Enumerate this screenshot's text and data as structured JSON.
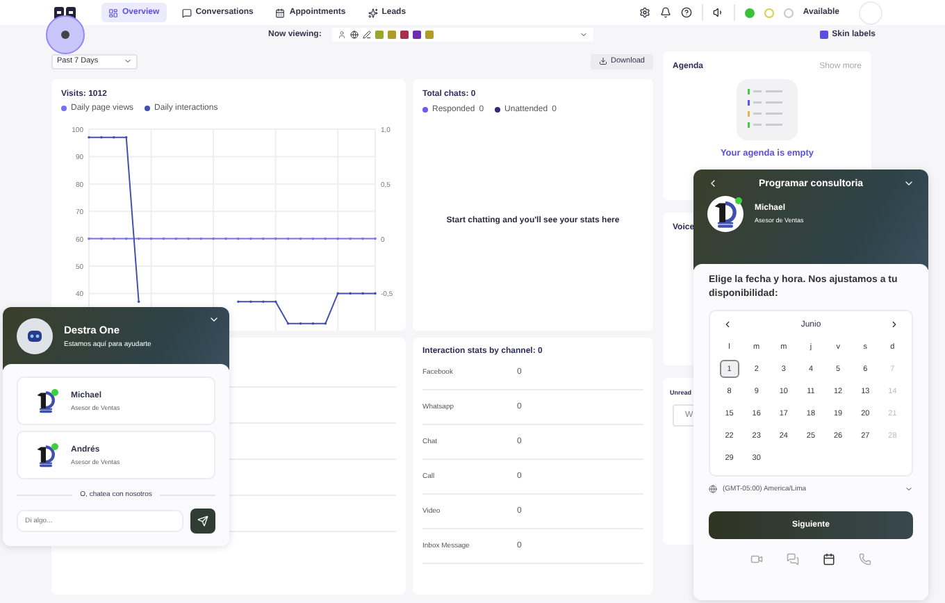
{
  "nav": {
    "tabs": [
      {
        "label": "Overview",
        "selected": true
      },
      {
        "label": "Conversations",
        "selected": false
      },
      {
        "label": "Appointments",
        "selected": false
      },
      {
        "label": "Leads",
        "selected": false
      }
    ],
    "statuses": [
      {
        "color": "#3cc03c",
        "selected": true
      },
      {
        "color": "#d8d040",
        "selected": false
      },
      {
        "color": "#c8c8cc",
        "selected": false
      }
    ],
    "status_label": "Available"
  },
  "viewing": {
    "label": "Now viewing:",
    "tags": [
      {
        "color": "#9aa52a"
      },
      {
        "color": "#b09a2a"
      },
      {
        "color": "#a8304c"
      },
      {
        "color": "#6e2cae"
      },
      {
        "color": "#b09a2a"
      }
    ]
  },
  "skin_labels": {
    "label": "Skin labels",
    "checked": true
  },
  "period": {
    "value": "Past 7 Days"
  },
  "download": "Download",
  "visits": {
    "title": "Visits: 1012",
    "chart_data": {
      "type": "line",
      "grid": true,
      "ylim": [
        25,
        100
      ],
      "yticks": [
        40,
        50,
        60,
        70,
        80,
        90,
        100
      ],
      "y2lim": [
        -0.875,
        1
      ],
      "y2ticks": [
        {
          "value": -0.5,
          "label": "-0,5"
        },
        {
          "value": 0,
          "label": "0"
        },
        {
          "value": 0.5,
          "label": "0,5"
        },
        {
          "value": 1,
          "label": "1,0"
        }
      ],
      "series": [
        {
          "name": "Daily page views",
          "color": "#7a70f0",
          "values": [
            60,
            60,
            60,
            60,
            60,
            60,
            60,
            60,
            60,
            60,
            60,
            60,
            60,
            60,
            60,
            60,
            60,
            60,
            60,
            60,
            60,
            60,
            60,
            60
          ]
        },
        {
          "name": "Daily interactions",
          "color": "#4450b0",
          "values": [
            97,
            97,
            97,
            97,
            37,
            null,
            null,
            null,
            null,
            null,
            null,
            null,
            37,
            37,
            37,
            37,
            29,
            29,
            29,
            29,
            40,
            40,
            40,
            40
          ]
        }
      ]
    }
  },
  "total_chats": {
    "title": "Total chats: 0",
    "legend": [
      {
        "label": "Responded",
        "value": "0",
        "color": "#6a5cf0"
      },
      {
        "label": "Unattended",
        "value": "0",
        "color": "#2f2a7a"
      }
    ],
    "empty": "Start chatting and you'll see your stats here"
  },
  "channels": {
    "title": "Interaction stats by channel: 0",
    "rows": [
      {
        "name": "Facebook",
        "value": "0"
      },
      {
        "name": "Whatsapp",
        "value": "0"
      },
      {
        "name": "Chat",
        "value": "0"
      },
      {
        "name": "Call",
        "value": "0"
      },
      {
        "name": "Video",
        "value": "0"
      },
      {
        "name": "Inbox Message",
        "value": "0"
      }
    ]
  },
  "agenda": {
    "title": "Agenda",
    "show_more": "Show more",
    "empty": "Your agenda is empty"
  },
  "voice": {
    "title": "Voice"
  },
  "unread": {
    "title": "Unread",
    "item": "W"
  },
  "chat_widget": {
    "title": "Destra One",
    "subtitle": "Estamos aquí para ayudarte",
    "agents": [
      {
        "name": "Michael",
        "role": "Asesor de Ventas",
        "online": true
      },
      {
        "name": "Andrés",
        "role": "Asesor de Ventas",
        "online": true
      }
    ],
    "divider": "O, chatea con nosotros",
    "placeholder": "Di algo..."
  },
  "booking": {
    "title": "Programar consultoria",
    "agent": {
      "name": "Michael",
      "role": "Asesor de Ventas",
      "online": true
    },
    "prompt": "Elige la fecha y hora. Nos ajustamos a tu disponibilidad:",
    "month": "Junio",
    "weekdays": [
      "l",
      "m",
      "m",
      "j",
      "v",
      "s",
      "d"
    ],
    "days": [
      {
        "label": "1",
        "selected": true,
        "disabled": false
      },
      {
        "label": "2",
        "selected": false,
        "disabled": false
      },
      {
        "label": "3",
        "selected": false,
        "disabled": false
      },
      {
        "label": "4",
        "selected": false,
        "disabled": false
      },
      {
        "label": "5",
        "selected": false,
        "disabled": false
      },
      {
        "label": "6",
        "selected": false,
        "disabled": false
      },
      {
        "label": "7",
        "selected": false,
        "disabled": true
      },
      {
        "label": "8",
        "selected": false,
        "disabled": false
      },
      {
        "label": "9",
        "selected": false,
        "disabled": false
      },
      {
        "label": "10",
        "selected": false,
        "disabled": false
      },
      {
        "label": "11",
        "selected": false,
        "disabled": false
      },
      {
        "label": "12",
        "selected": false,
        "disabled": false
      },
      {
        "label": "13",
        "selected": false,
        "disabled": false
      },
      {
        "label": "14",
        "selected": false,
        "disabled": true
      },
      {
        "label": "15",
        "selected": false,
        "disabled": false
      },
      {
        "label": "16",
        "selected": false,
        "disabled": false
      },
      {
        "label": "17",
        "selected": false,
        "disabled": false
      },
      {
        "label": "18",
        "selected": false,
        "disabled": false
      },
      {
        "label": "19",
        "selected": false,
        "disabled": false
      },
      {
        "label": "20",
        "selected": false,
        "disabled": false
      },
      {
        "label": "21",
        "selected": false,
        "disabled": true
      },
      {
        "label": "22",
        "selected": false,
        "disabled": false
      },
      {
        "label": "23",
        "selected": false,
        "disabled": false
      },
      {
        "label": "24",
        "selected": false,
        "disabled": false
      },
      {
        "label": "25",
        "selected": false,
        "disabled": false
      },
      {
        "label": "26",
        "selected": false,
        "disabled": false
      },
      {
        "label": "27",
        "selected": false,
        "disabled": false
      },
      {
        "label": "28",
        "selected": false,
        "disabled": true
      },
      {
        "label": "29",
        "selected": false,
        "disabled": false
      },
      {
        "label": "30",
        "selected": false,
        "disabled": false
      }
    ],
    "timezone": "(GMT-05:00) America/Lima",
    "button": "Siguiente",
    "footer": [
      {
        "kind": "video",
        "selected": false
      },
      {
        "kind": "chat",
        "selected": false
      },
      {
        "kind": "calendar",
        "selected": true
      },
      {
        "kind": "phone",
        "selected": false
      }
    ]
  }
}
